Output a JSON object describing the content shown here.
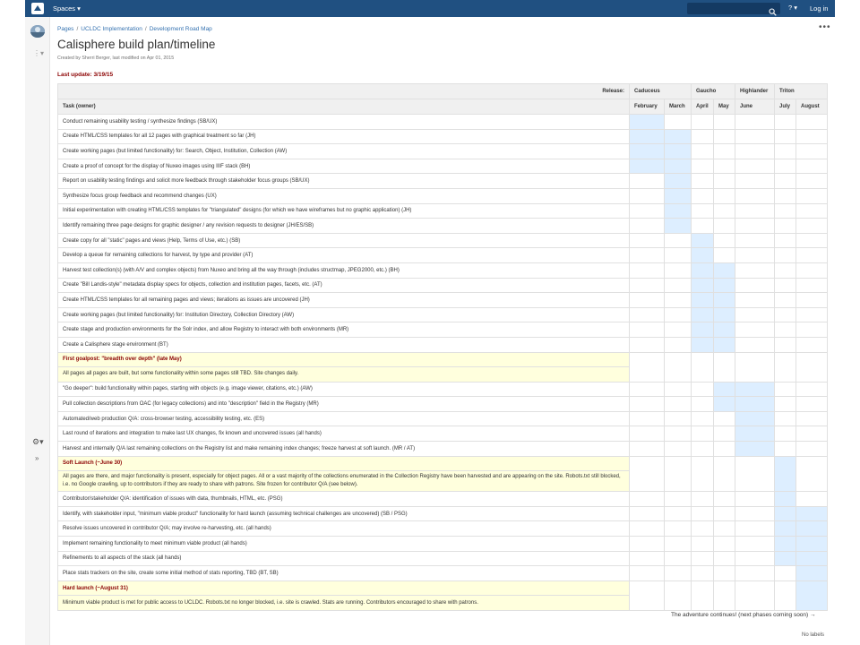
{
  "header": {
    "spaces_label": "Spaces ▾",
    "help_label": "? ▾",
    "login_label": "Log in",
    "search_placeholder": ""
  },
  "breadcrumb": [
    "Pages",
    "UCLDC Implementation",
    "Development Road Map"
  ],
  "page": {
    "title": "Calisphere build plan/timeline",
    "byline": "Created by Sherri Berger, last modified on Apr 01, 2015",
    "last_update": "Last update: 3/19/15"
  },
  "table": {
    "release_label": "Release:",
    "releases": [
      {
        "name": "Caduceus",
        "span": 2
      },
      {
        "name": "Gaucho",
        "span": 2
      },
      {
        "name": "Highlander",
        "span": 1
      },
      {
        "name": "Triton",
        "span": 2
      }
    ],
    "task_header": "Task (owner)",
    "months": [
      "February",
      "March",
      "April",
      "May",
      "June",
      "July",
      "August"
    ],
    "rows": [
      {
        "type": "task",
        "text": "Conduct remaining usability testing / synthesize findings (SB/UX)",
        "on": [
          1,
          0,
          0,
          0,
          0,
          0,
          0
        ]
      },
      {
        "type": "task",
        "text": "Create HTML/CSS templates for all 12 pages with graphical treatment so far (JH)",
        "on": [
          1,
          1,
          0,
          0,
          0,
          0,
          0
        ]
      },
      {
        "type": "task",
        "text": "Create working pages (but limited functionality) for: Search, Object, Institution, Collection (AW)",
        "on": [
          1,
          1,
          0,
          0,
          0,
          0,
          0
        ]
      },
      {
        "type": "task",
        "text": "Create a proof of concept for the display of Nuxeo images using IIIF stack (BH)",
        "on": [
          1,
          1,
          0,
          0,
          0,
          0,
          0
        ]
      },
      {
        "type": "task",
        "text": "Report on usability testing findings and solicit more feedback through stakeholder focus groups (SB/UX)",
        "on": [
          0,
          1,
          0,
          0,
          0,
          0,
          0
        ]
      },
      {
        "type": "task",
        "text": "Synthesize focus group feedback and recommend changes (UX)",
        "on": [
          0,
          1,
          0,
          0,
          0,
          0,
          0
        ]
      },
      {
        "type": "task",
        "text": "Initial experimentation with creating HTML/CSS templates for \"triangulated\" designs (for which we have wireframes but no graphic application) (JH)",
        "on": [
          0,
          1,
          0,
          0,
          0,
          0,
          0
        ]
      },
      {
        "type": "task",
        "text": "Identify remaining three page designs for graphic designer / any revision requests to designer (JH/ES/SB)",
        "on": [
          0,
          1,
          0,
          0,
          0,
          0,
          0
        ]
      },
      {
        "type": "task",
        "text": "Create copy for all \"static\" pages and views (Help, Terms of Use, etc.) (SB)",
        "on": [
          0,
          0,
          1,
          0,
          0,
          0,
          0
        ]
      },
      {
        "type": "task",
        "text": "Develop a queue for remaining collections for harvest, by type and provider (AT)",
        "on": [
          0,
          0,
          1,
          0,
          0,
          0,
          0
        ]
      },
      {
        "type": "task",
        "text": "Harvest test collection(s) (with A/V and complex objects) from Nuxeo and bring all the way through (includes structmap, JPEG2000, etc.) (BH)",
        "on": [
          0,
          0,
          1,
          1,
          0,
          0,
          0
        ]
      },
      {
        "type": "task",
        "text": "Create \"Bill Landis-style\" metadata display specs for objects, collection and institution pages, facets, etc. (AT)",
        "on": [
          0,
          0,
          1,
          1,
          0,
          0,
          0
        ]
      },
      {
        "type": "task",
        "text": "Create HTML/CSS templates for all remaining pages and views; iterations as issues are uncovered (JH)",
        "on": [
          0,
          0,
          1,
          1,
          0,
          0,
          0
        ]
      },
      {
        "type": "task",
        "text": "Create working pages (but limited functionality) for: Institution Directory, Collection Directory (AW)",
        "on": [
          0,
          0,
          1,
          1,
          0,
          0,
          0
        ]
      },
      {
        "type": "task",
        "text": "Create stage and production environments for the Solr index, and allow Registry to interact with both environments (MR)",
        "on": [
          0,
          0,
          1,
          1,
          0,
          0,
          0
        ]
      },
      {
        "type": "task",
        "text": "Create a Calisphere stage environment (BT)",
        "on": [
          0,
          0,
          1,
          1,
          0,
          0,
          0
        ]
      },
      {
        "type": "goal",
        "title": "First goalpost: \"breadth over depth\" (late May)",
        "text": "All pages all pages are built, but some functionality within some pages still TBD. Site changes daily.",
        "on": [
          0,
          0,
          0,
          0,
          0,
          0,
          0
        ]
      },
      {
        "type": "task",
        "text": "\"Go deeper\": build functionality within pages, starting with objects (e.g. image viewer, citations, etc.) (AW)",
        "on": [
          0,
          0,
          0,
          1,
          1,
          0,
          0
        ]
      },
      {
        "type": "task",
        "text": "Pull collection descriptions from OAC (for legacy collections) and into \"description\" field in the Registry (MR)",
        "on": [
          0,
          0,
          0,
          1,
          1,
          0,
          0
        ]
      },
      {
        "type": "task",
        "text": "Automated/web production Q/A: cross-browser testing, accessibility testing, etc. (ES)",
        "on": [
          0,
          0,
          0,
          0,
          1,
          0,
          0
        ]
      },
      {
        "type": "task",
        "text": "Last round of iterations and integration to make last UX changes, fix known and uncovered issues (all hands)",
        "on": [
          0,
          0,
          0,
          0,
          1,
          0,
          0
        ]
      },
      {
        "type": "task",
        "text": "Harvest and internally Q/A last remaining collections on the Registry list and make remaining index changes; freeze harvest at soft launch. (MR / AT)",
        "on": [
          0,
          0,
          0,
          0,
          1,
          0,
          0
        ]
      },
      {
        "type": "goal",
        "title": "Soft Launch (~June 30)",
        "text": "All pages are there, and major functionality is present, especially for object pages. All or a vast majority of the collections enumerated in the Collection Registry have been harvested and are appearing on the site. Robots.txt still blocked, i.e. no Google crawling, up to contributors if they are ready to share with patrons. Site frozen for contributor Q/A (see below).",
        "on": [
          0,
          0,
          0,
          0,
          0,
          1,
          0
        ]
      },
      {
        "type": "task",
        "text": "Contributor/stakeholder Q/A: identification of issues with data, thumbnails, HTML, etc. (PSG)",
        "on": [
          0,
          0,
          0,
          0,
          0,
          1,
          0
        ]
      },
      {
        "type": "task",
        "text": "Identify, with stakeholder input, \"minimum viable product\" functionality for hard launch (assuming technical challenges are uncovered) (SB / PSG)",
        "on": [
          0,
          0,
          0,
          0,
          0,
          1,
          1
        ]
      },
      {
        "type": "task",
        "text": "Resolve issues uncovered in contributor Q/A; may involve re-harvesting, etc. (all hands)",
        "on": [
          0,
          0,
          0,
          0,
          0,
          1,
          1
        ]
      },
      {
        "type": "task",
        "text": "Implement remaining functionality to meet minimum viable product (all hands)",
        "on": [
          0,
          0,
          0,
          0,
          0,
          1,
          1
        ]
      },
      {
        "type": "task",
        "text": "Refinements to all aspects of the stack (all hands)",
        "on": [
          0,
          0,
          0,
          0,
          0,
          1,
          1
        ]
      },
      {
        "type": "task",
        "text": "Place stats trackers on the site, create some initial method of stats reporting, TBD (BT, SB)",
        "on": [
          0,
          0,
          0,
          0,
          0,
          0,
          1
        ]
      },
      {
        "type": "goal",
        "title": "Hard launch (~August 31)",
        "text": "Minimum viable product is met for public access to UCLDC. Robots.txt no longer blocked, i.e. site is crawled. Stats are running. Contributors encouraged to share with patrons.",
        "on": [
          0,
          0,
          0,
          0,
          0,
          0,
          1
        ]
      }
    ],
    "footer": "The adventure continues! (next phases coming soon) →"
  },
  "labels": "No labels",
  "colors": {
    "header_bg": "#205081",
    "highlight": "#ddeeff",
    "goal_bg": "#ffffdd",
    "goal_title": "#8b0000",
    "link": "#3572b0"
  }
}
